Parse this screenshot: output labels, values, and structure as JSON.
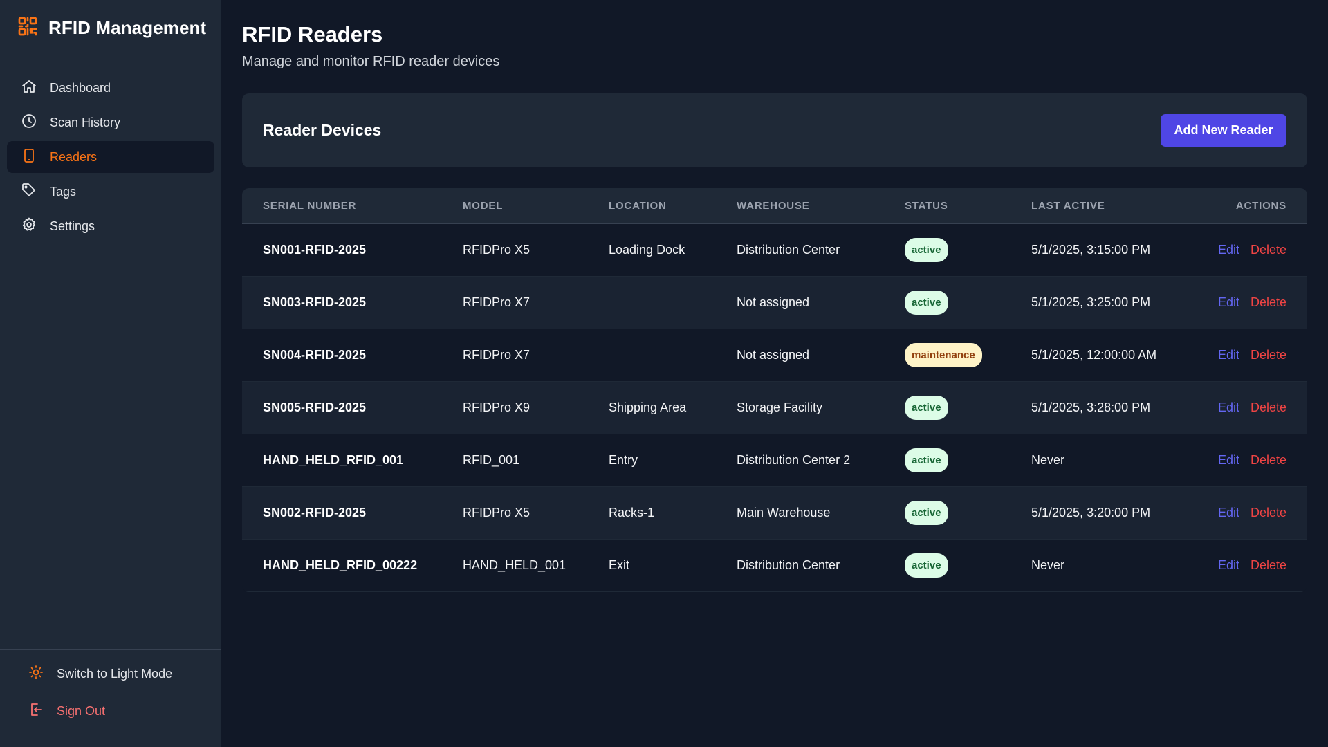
{
  "sidebar": {
    "brand": "RFID Management",
    "items": [
      {
        "label": "Dashboard",
        "icon": "home-icon",
        "active": false
      },
      {
        "label": "Scan History",
        "icon": "clock-icon",
        "active": false
      },
      {
        "label": "Readers",
        "icon": "tablet-icon",
        "active": true
      },
      {
        "label": "Tags",
        "icon": "tag-icon",
        "active": false
      },
      {
        "label": "Settings",
        "icon": "gear-icon",
        "active": false
      }
    ],
    "theme_toggle": "Switch to Light Mode",
    "sign_out": "Sign Out"
  },
  "header": {
    "title": "RFID Readers",
    "subtitle": "Manage and monitor RFID reader devices"
  },
  "card": {
    "title": "Reader Devices",
    "add_button": "Add New Reader"
  },
  "table": {
    "columns": [
      "Serial Number",
      "Model",
      "Location",
      "Warehouse",
      "Status",
      "Last Active",
      "Actions"
    ],
    "rows": [
      {
        "serial": "SN001-RFID-2025",
        "model": "RFIDPro X5",
        "location": "Loading Dock",
        "warehouse": "Distribution Center",
        "status": "active",
        "last_active": "5/1/2025, 3:15:00 PM"
      },
      {
        "serial": "SN003-RFID-2025",
        "model": "RFIDPro X7",
        "location": "",
        "warehouse": "Not assigned",
        "status": "active",
        "last_active": "5/1/2025, 3:25:00 PM"
      },
      {
        "serial": "SN004-RFID-2025",
        "model": "RFIDPro X7",
        "location": "",
        "warehouse": "Not assigned",
        "status": "maintenance",
        "last_active": "5/1/2025, 12:00:00 AM"
      },
      {
        "serial": "SN005-RFID-2025",
        "model": "RFIDPro X9",
        "location": "Shipping Area",
        "warehouse": "Storage Facility",
        "status": "active",
        "last_active": "5/1/2025, 3:28:00 PM"
      },
      {
        "serial": "HAND_HELD_RFID_001",
        "model": "RFID_001",
        "location": "Entry",
        "warehouse": "Distribution Center 2",
        "status": "active",
        "last_active": "Never"
      },
      {
        "serial": "SN002-RFID-2025",
        "model": "RFIDPro X5",
        "location": "Racks-1",
        "warehouse": "Main Warehouse",
        "status": "active",
        "last_active": "5/1/2025, 3:20:00 PM"
      },
      {
        "serial": "HAND_HELD_RFID_00222",
        "model": "HAND_HELD_001",
        "location": "Exit",
        "warehouse": "Distribution Center",
        "status": "active",
        "last_active": "Never"
      }
    ],
    "edit_label": "Edit",
    "delete_label": "Delete"
  },
  "colors": {
    "accent": "#f97316",
    "primary_button": "#4f46e5",
    "edit": "#6366f1",
    "delete": "#ef4444",
    "active_badge_bg": "#dcfce7",
    "maintenance_badge_bg": "#fef3c7"
  }
}
